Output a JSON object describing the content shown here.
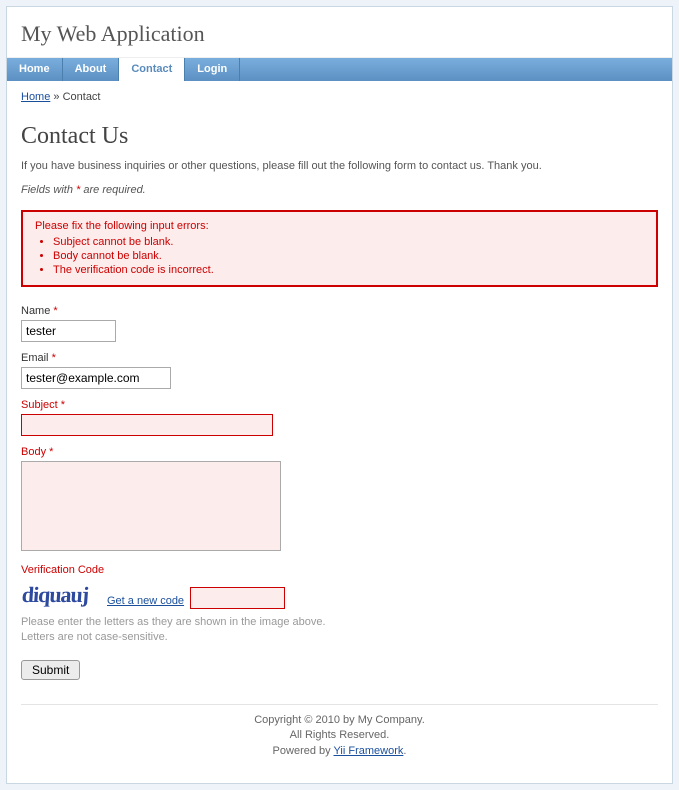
{
  "header": {
    "title": "My Web Application"
  },
  "menu": {
    "items": [
      {
        "label": "Home"
      },
      {
        "label": "About"
      },
      {
        "label": "Contact"
      },
      {
        "label": "Login"
      }
    ]
  },
  "breadcrumb": {
    "home": "Home",
    "sep": " » ",
    "current": "Contact"
  },
  "main": {
    "heading": "Contact Us",
    "intro": "If you have business inquiries or other questions, please fill out the following form to contact us. Thank you.",
    "fields_note_prefix": "Fields with ",
    "fields_note_star": "*",
    "fields_note_suffix": " are required."
  },
  "errors": {
    "title": "Please fix the following input errors:",
    "items": [
      "Subject cannot be blank.",
      "Body cannot be blank.",
      "The verification code is incorrect."
    ]
  },
  "form": {
    "name": {
      "label": "Name",
      "value": "tester"
    },
    "email": {
      "label": "Email",
      "value": "tester@example.com"
    },
    "subject": {
      "label": "Subject",
      "value": ""
    },
    "body": {
      "label": "Body",
      "value": ""
    },
    "verify": {
      "label": "Verification Code",
      "captcha_text": "diquauj",
      "new_code": "Get a new code",
      "value": "",
      "hint_l1": "Please enter the letters as they are shown in the image above.",
      "hint_l2": "Letters are not case-sensitive."
    },
    "submit": "Submit",
    "star": "*"
  },
  "footer": {
    "copyright": "Copyright © 2010 by My Company.",
    "rights": "All Rights Reserved.",
    "powered_prefix": "Powered by ",
    "powered_link": "Yii Framework",
    "powered_suffix": "."
  }
}
